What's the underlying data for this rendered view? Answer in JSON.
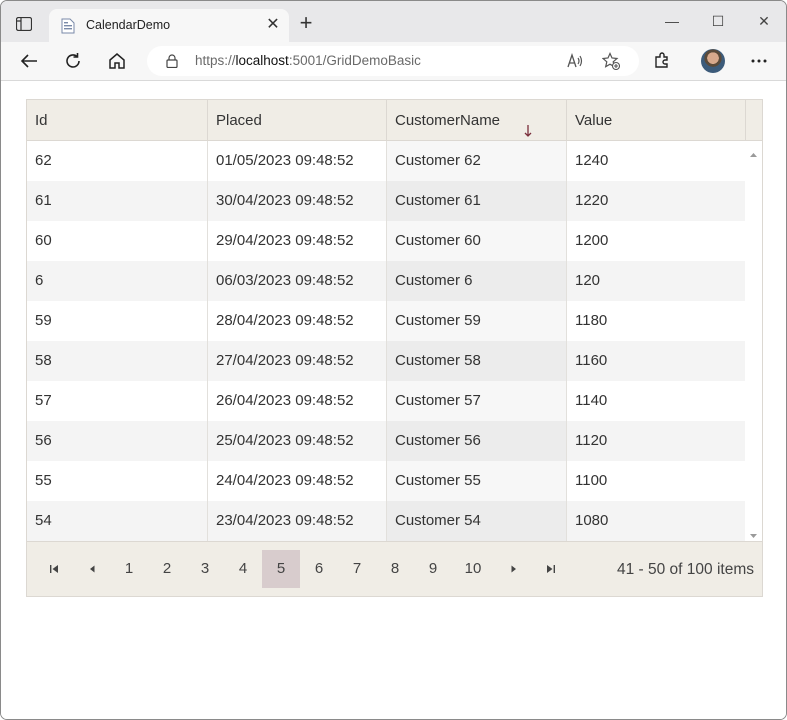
{
  "browser": {
    "tab_title": "CalendarDemo",
    "tab_close": "✕",
    "new_tab": "+",
    "minimize": "—",
    "maximize": "☐",
    "close": "✕",
    "url_prefix": "https://",
    "url_host": "localhost",
    "url_rest": ":5001/GridDemoBasic"
  },
  "grid": {
    "columns": [
      "Id",
      "Placed",
      "CustomerName",
      "Value"
    ],
    "sorted_column": "CustomerName",
    "sort_direction": "descending",
    "rows": [
      [
        "62",
        "01/05/2023 09:48:52",
        "Customer 62",
        "1240"
      ],
      [
        "61",
        "30/04/2023 09:48:52",
        "Customer 61",
        "1220"
      ],
      [
        "60",
        "29/04/2023 09:48:52",
        "Customer 60",
        "1200"
      ],
      [
        "6",
        "06/03/2023 09:48:52",
        "Customer 6",
        "120"
      ],
      [
        "59",
        "28/04/2023 09:48:52",
        "Customer 59",
        "1180"
      ],
      [
        "58",
        "27/04/2023 09:48:52",
        "Customer 58",
        "1160"
      ],
      [
        "57",
        "26/04/2023 09:48:52",
        "Customer 57",
        "1140"
      ],
      [
        "56",
        "25/04/2023 09:48:52",
        "Customer 56",
        "1120"
      ],
      [
        "55",
        "24/04/2023 09:48:52",
        "Customer 55",
        "1100"
      ],
      [
        "54",
        "23/04/2023 09:48:52",
        "Customer 54",
        "1080"
      ]
    ]
  },
  "pager": {
    "pages": [
      "1",
      "2",
      "3",
      "4",
      "5",
      "6",
      "7",
      "8",
      "9",
      "10"
    ],
    "current_page": "5",
    "info": "41 - 50 of 100 items"
  },
  "colors": {
    "header_bg": "#f0ede6",
    "active_page_bg": "#d8cccd",
    "alt_row_bg": "#f4f4f4"
  }
}
